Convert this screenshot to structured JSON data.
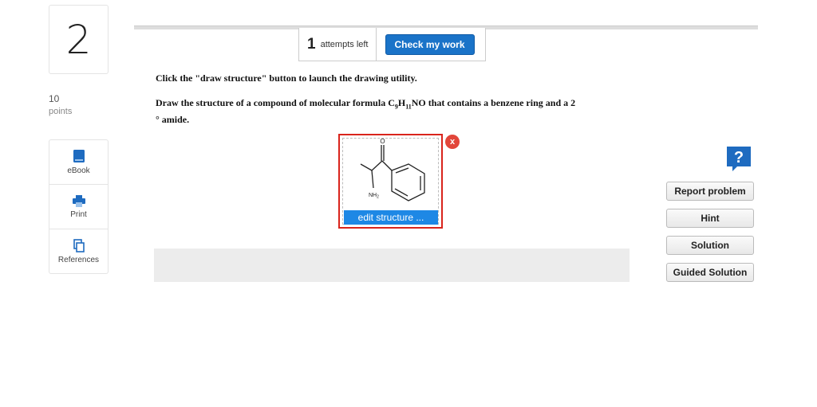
{
  "question": {
    "number": "2",
    "points_value": "10",
    "points_label": "points"
  },
  "tools": [
    {
      "label": "eBook",
      "icon": "book-icon"
    },
    {
      "label": "Print",
      "icon": "printer-icon"
    },
    {
      "label": "References",
      "icon": "references-icon"
    }
  ],
  "topbar": {
    "attempts_number": "1",
    "attempts_text": "attempts left",
    "check_label": "Check my work"
  },
  "prompt": {
    "line1": "Click the \"draw structure\" button to launch the drawing utility.",
    "line2_pre": "Draw the structure of a compound of molecular formula C",
    "sub1": "9",
    "mid1": "H",
    "sub2": "11",
    "line2_post": "NO that contains a benzene ring and a 2",
    "line3": "° amide."
  },
  "drawing": {
    "atom_o": "O",
    "atom_nh2": "NH",
    "atom_nh2_sub": "2",
    "close_label": "x",
    "edit_label": "edit structure ..."
  },
  "right_panel": {
    "help_label": "?",
    "buttons": [
      "Report problem",
      "Hint",
      "Solution",
      "Guided Solution"
    ]
  },
  "colors": {
    "accent": "#1a73c8",
    "highlight_border": "#d9241c"
  }
}
